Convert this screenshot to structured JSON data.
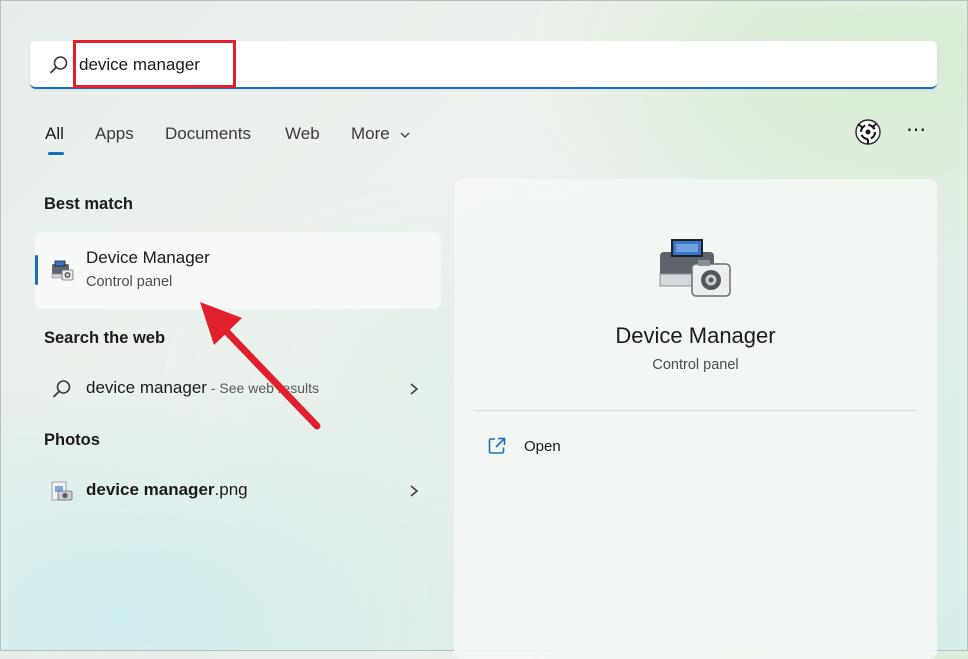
{
  "search": {
    "value": "device manager",
    "icon": "search-icon"
  },
  "tabs": [
    {
      "label": "All",
      "active": true
    },
    {
      "label": "Apps"
    },
    {
      "label": "Documents"
    },
    {
      "label": "Web"
    },
    {
      "label": "More"
    }
  ],
  "toolbar": {
    "account_icon": "account-avatar-icon",
    "more_icon": "more-options-icon",
    "more_label": "⋯"
  },
  "best_match": {
    "heading": "Best match",
    "title": "Device Manager",
    "subtitle": "Control panel",
    "icon": "device-manager-icon"
  },
  "web": {
    "heading": "Search the web",
    "query": "device manager",
    "suffix": " - See web results",
    "icon": "search-icon"
  },
  "photos": {
    "heading": "Photos",
    "name_bold": "device manager",
    "name_ext": ".png",
    "icon": "image-file-icon"
  },
  "detail": {
    "title": "Device Manager",
    "subtitle": "Control panel",
    "open_label": "Open",
    "open_icon": "open-external-icon"
  },
  "colors": {
    "accent": "#1a6fb8",
    "annotation": "#e0202d"
  }
}
